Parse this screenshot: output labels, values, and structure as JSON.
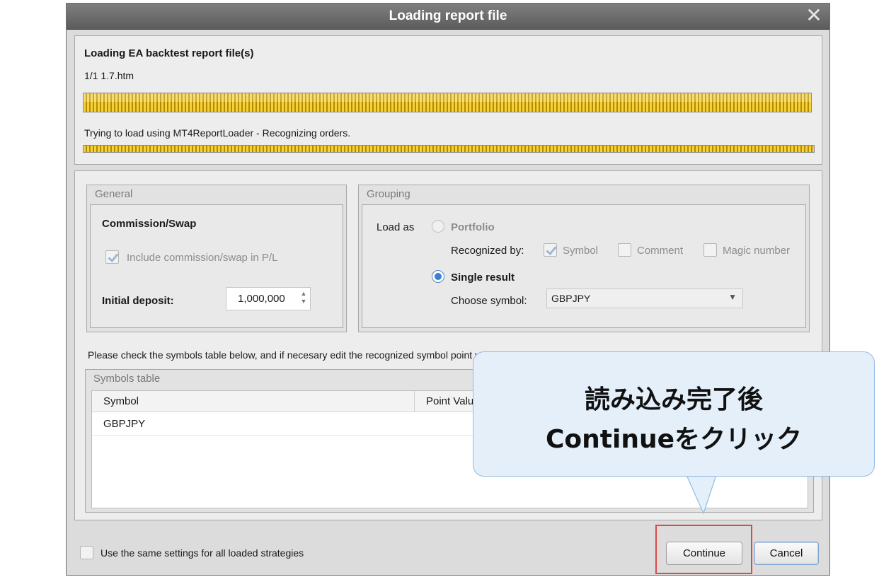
{
  "window": {
    "title": "Loading report file"
  },
  "loading": {
    "heading": "Loading EA backtest report file(s)",
    "file_status": "1/1 1.7.htm",
    "file_progress": 1.0,
    "status_text": "Trying to load using MT4ReportLoader - Recognizing orders.",
    "status_progress": 1.0
  },
  "general": {
    "title": "General",
    "commission_heading": "Commission/Swap",
    "include_commission_label": "Include commission/swap in P/L",
    "include_commission_checked": true,
    "initial_deposit_label": "Initial deposit:",
    "initial_deposit_value": "1,000,000"
  },
  "grouping": {
    "title": "Grouping",
    "load_as_label": "Load as",
    "portfolio_label": "Portfolio",
    "recognized_by_label": "Recognized by:",
    "symbol_label": "Symbol",
    "symbol_checked": true,
    "comment_label": "Comment",
    "comment_checked": false,
    "magic_label": "Magic number",
    "magic_checked": false,
    "single_result_label": "Single result",
    "single_result_selected": true,
    "choose_symbol_label": "Choose symbol:",
    "choose_symbol_value": "GBPJPY"
  },
  "instruction_text": "Please check the symbols table below, and if necesary edit the recognized symbol point value or tick size.",
  "symbols_table": {
    "title": "Symbols table",
    "columns": [
      "Symbol",
      "Point Value"
    ],
    "rows": [
      [
        "GBPJPY",
        ""
      ]
    ]
  },
  "footer": {
    "same_settings_label": "Use the same settings for all loaded strategies",
    "same_settings_checked": false,
    "continue_label": "Continue",
    "cancel_label": "Cancel"
  },
  "callout": {
    "line1": "読み込み完了後",
    "line2": "Continueをクリック"
  },
  "colors": {
    "progress": "#f0c419",
    "highlight": "#e04848",
    "callout_bg": "#e4effa",
    "callout_border": "#8fbbe6"
  }
}
